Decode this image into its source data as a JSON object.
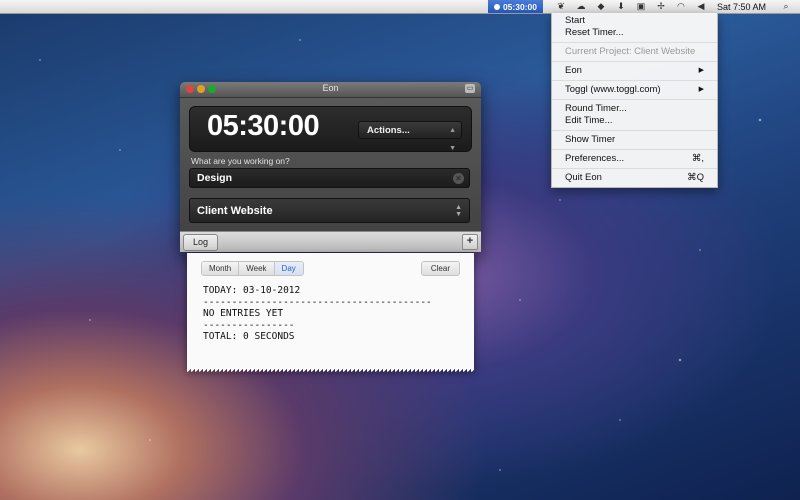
{
  "menubar": {
    "timer": "05:30:00",
    "clock": "Sat 7:50 AM"
  },
  "dropdown": {
    "items": [
      {
        "label": "Start",
        "shortcut": "",
        "disabled": false
      },
      {
        "label": "Reset Timer...",
        "shortcut": "",
        "disabled": false
      },
      {
        "label": "Current Project: Client Website",
        "shortcut": "",
        "disabled": true
      },
      {
        "label": "Eon",
        "shortcut": "▶",
        "disabled": false
      },
      {
        "label": "Toggl (www.toggl.com)",
        "shortcut": "▶",
        "disabled": false
      },
      {
        "label": "Round Timer...",
        "shortcut": "",
        "disabled": false
      },
      {
        "label": "Edit Time...",
        "shortcut": "",
        "disabled": false
      },
      {
        "label": "Show Timer",
        "shortcut": "",
        "disabled": false
      },
      {
        "label": "Preferences...",
        "shortcut": "⌘,",
        "disabled": false
      },
      {
        "label": "Quit Eon",
        "shortcut": "⌘Q",
        "disabled": false
      }
    ]
  },
  "window": {
    "title": "Eon",
    "time": "05:30:00",
    "actions_label": "Actions...",
    "question": "What are you working on?",
    "task_value": "Design",
    "project_value": "Client Website",
    "log_label": "Log",
    "plus_label": "+"
  },
  "log": {
    "tabs": [
      "Month",
      "Week",
      "Day"
    ],
    "active_tab": "Day",
    "clear_label": "Clear",
    "line1": "TODAY: 03-10-2012",
    "rule1": "----------------------------------------",
    "line2": "NO ENTRIES YET",
    "rule2": "----------------",
    "line3": "TOTAL: 0 SECONDS"
  },
  "colors": {
    "accent": "#2a64c8",
    "menubar_highlight": "#2456b8"
  }
}
